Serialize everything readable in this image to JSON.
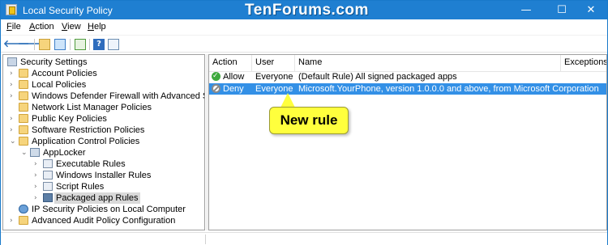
{
  "window": {
    "title": "Local Security Policy",
    "watermark": "TenForums.com",
    "minimize_glyph": "—",
    "maximize_glyph": "☐",
    "close_glyph": "✕"
  },
  "menu": {
    "file": "File",
    "action": "Action",
    "view": "View",
    "help": "Help"
  },
  "toolbar": {
    "back_icon": "back-arrow-icon",
    "forward_icon": "forward-arrow-icon",
    "help_glyph": "?"
  },
  "tree": {
    "root": "Security Settings",
    "items": [
      {
        "label": "Account Policies",
        "icon": "folder-icon"
      },
      {
        "label": "Local Policies",
        "icon": "folder-icon"
      },
      {
        "label": "Windows Defender Firewall with Advanced Security",
        "icon": "folder-icon"
      },
      {
        "label": "Network List Manager Policies",
        "icon": "folder-icon"
      },
      {
        "label": "Public Key Policies",
        "icon": "folder-icon"
      },
      {
        "label": "Software Restriction Policies",
        "icon": "folder-icon"
      },
      {
        "label": "Application Control Policies",
        "icon": "folder-icon"
      },
      {
        "label": "AppLocker",
        "icon": "applocker-icon"
      },
      {
        "label": "Executable Rules",
        "icon": "rules-icon"
      },
      {
        "label": "Windows Installer Rules",
        "icon": "rules-icon"
      },
      {
        "label": "Script Rules",
        "icon": "rules-icon"
      },
      {
        "label": "Packaged app Rules",
        "icon": "packaged-app-icon"
      },
      {
        "label": "IP Security Policies on Local Computer",
        "icon": "network-icon"
      },
      {
        "label": "Advanced Audit Policy Configuration",
        "icon": "folder-icon"
      }
    ]
  },
  "list": {
    "columns": [
      "Action",
      "User",
      "Name",
      "Exceptions"
    ],
    "rows": [
      {
        "action": "Allow",
        "user": "Everyone",
        "name": "(Default Rule) All signed packaged apps",
        "exceptions": ""
      },
      {
        "action": "Deny",
        "user": "Everyone",
        "name": "Microsoft.YourPhone, version 1.0.0.0 and above, from Microsoft Corporation",
        "exceptions": ""
      }
    ]
  },
  "callout": {
    "text": "New rule"
  },
  "colors": {
    "titlebar": "#1f7fd1",
    "selection": "#3390e6",
    "callout": "#ffff3d"
  }
}
